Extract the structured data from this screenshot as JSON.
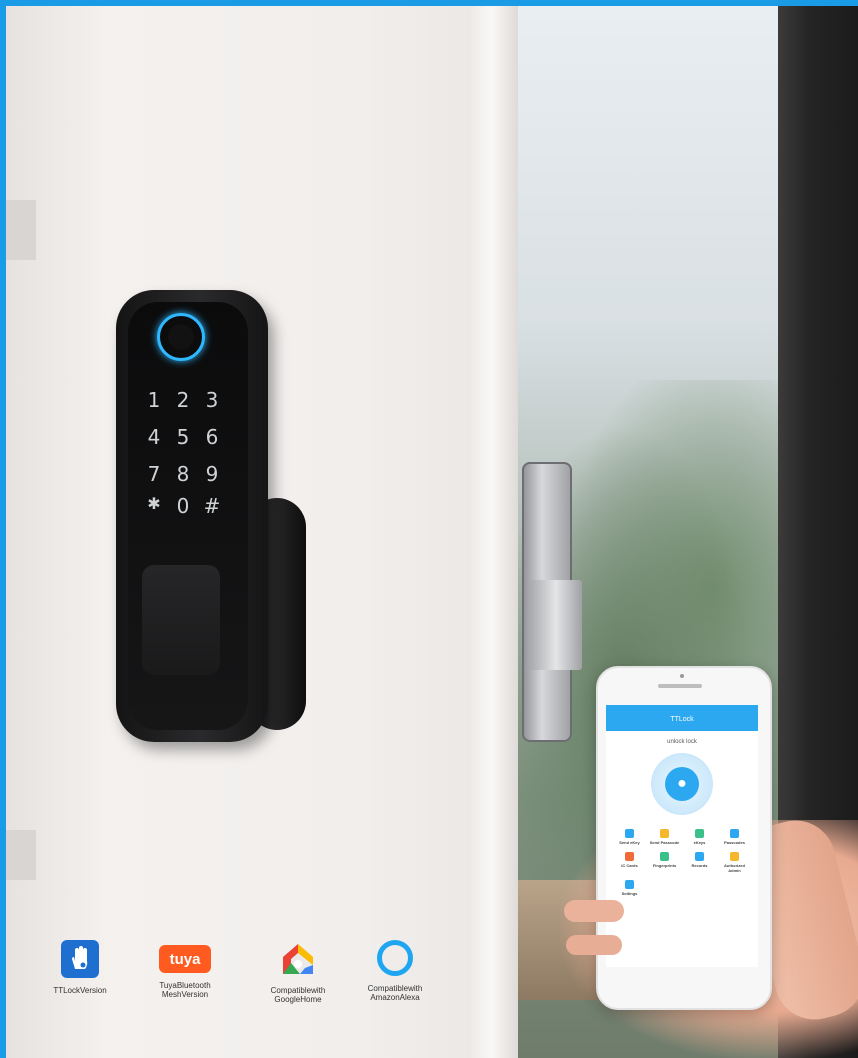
{
  "badges": [
    {
      "icon": "ttlock-hand-icon",
      "caption": "TTLockVersion"
    },
    {
      "icon": "tuya-logo",
      "logo_text": "tuya",
      "caption_line1": "TuyaBluetooth",
      "caption_line2": "MeshVersion"
    },
    {
      "icon": "google-home-icon",
      "caption_line1": "Compatiblewith",
      "caption_line2": "GoogleHome"
    },
    {
      "icon": "alexa-ring-icon",
      "caption_line1": "Compatiblewith",
      "caption_line2": "AmazonAlexa"
    }
  ],
  "keypad": {
    "keys": [
      "1",
      "2",
      "3",
      "4",
      "5",
      "6",
      "7",
      "8",
      "9",
      "✱",
      "0",
      "#"
    ]
  },
  "phone_app": {
    "title": "TTLock",
    "status": "unlock lock",
    "grid_items": [
      "Send eKey",
      "Send Passcode",
      "eKeys",
      "Passcodes",
      "IC Cards",
      "Fingerprints",
      "Records",
      "Authorized Admin",
      "Settings"
    ]
  },
  "colors": {
    "frame_blue": "#1a9be6",
    "fingerprint_ring": "#2fb7ff",
    "tuya_orange": "#ff5a1f",
    "app_blue": "#2ca8f0"
  }
}
